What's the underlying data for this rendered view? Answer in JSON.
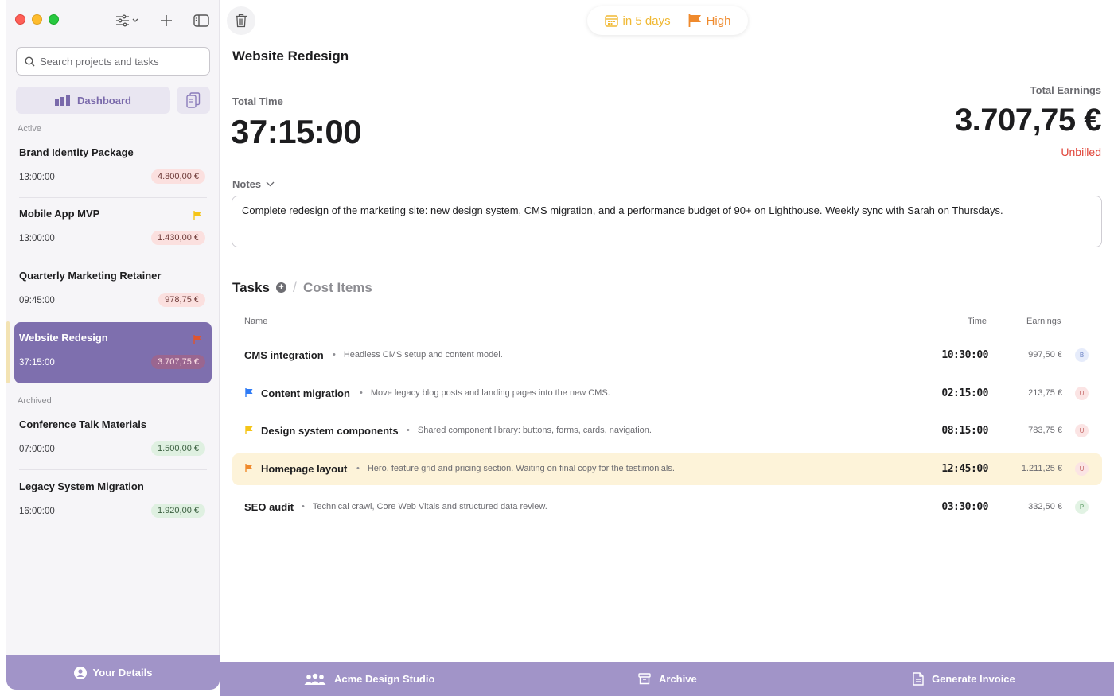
{
  "sidebar": {
    "search_placeholder": "Search projects and tasks",
    "dashboard_label": "Dashboard",
    "section_active": "Active",
    "section_archived": "Archived",
    "active_projects": [
      {
        "name": "Brand Identity Package",
        "time": "13:00:00",
        "amount": "4.800,00 €",
        "status": "unbilled"
      },
      {
        "name": "Mobile App MVP",
        "time": "13:00:00",
        "amount": "1.430,00 €",
        "status": "unbilled",
        "flag": "yellow"
      },
      {
        "name": "Quarterly Marketing Retainer",
        "time": "09:45:00",
        "amount": "978,75 €",
        "status": "unbilled"
      },
      {
        "name": "Website Redesign",
        "time": "37:15:00",
        "amount": "3.707,75 €",
        "status": "unbilled",
        "flag": "orange",
        "selected": true
      }
    ],
    "archived_projects": [
      {
        "name": "Conference Talk Materials",
        "time": "07:00:00",
        "amount": "1.500,00 €",
        "status": "billed"
      },
      {
        "name": "Legacy System Migration",
        "time": "16:00:00",
        "amount": "1.920,00 €",
        "status": "billed"
      }
    ],
    "your_details_label": "Your Details"
  },
  "header": {
    "due_label": "in 5 days",
    "priority_label": "High"
  },
  "project": {
    "title": "Website Redesign",
    "total_time_label": "Total Time",
    "total_time": "37:15:00",
    "total_earnings_label": "Total Earnings",
    "total_earnings": "3.707,75 €",
    "billing_status": "Unbilled",
    "notes_label": "Notes",
    "notes": "Complete redesign of the marketing site: new design system, CMS migration, and a performance budget of 90+ on Lighthouse. Weekly sync with Sarah on Thursdays."
  },
  "tabs": {
    "tasks": "Tasks",
    "separator": "/",
    "cost_items": "Cost Items"
  },
  "table": {
    "col_name": "Name",
    "col_time": "Time",
    "col_earnings": "Earnings",
    "rows": [
      {
        "name": "CMS integration",
        "desc": "Headless CMS setup and content model.",
        "time": "10:30:00",
        "earnings": "997,50 €",
        "avatar": "B",
        "flag": null
      },
      {
        "name": "Content migration",
        "desc": "Move legacy blog posts and landing pages into the new CMS.",
        "time": "02:15:00",
        "earnings": "213,75 €",
        "avatar": "U",
        "flag": "blue"
      },
      {
        "name": "Design system components",
        "desc": "Shared component library: buttons, forms, cards, navigation.",
        "time": "08:15:00",
        "earnings": "783,75 €",
        "avatar": "U",
        "flag": "yellow"
      },
      {
        "name": "Homepage layout",
        "desc": "Hero, feature grid and pricing section. Waiting on final copy for the testimonials.",
        "time": "12:45:00",
        "earnings": "1.211,25 €",
        "avatar": "U",
        "flag": "orange",
        "highlighted": true
      },
      {
        "name": "SEO audit",
        "desc": "Technical crawl, Core Web Vitals and structured data review.",
        "time": "03:30:00",
        "earnings": "332,50 €",
        "avatar": "P",
        "flag": null
      }
    ]
  },
  "bottom_bar": {
    "client": "Acme Design Studio",
    "archive": "Archive",
    "invoice": "Generate Invoice"
  },
  "colors": {
    "accent": "#7e6fae",
    "bar": "#a194c8",
    "unbilled": "#e0453a",
    "flag_yellow": "#f5c518",
    "flag_orange": "#ef8a2d",
    "flag_blue": "#2f7bf5"
  }
}
